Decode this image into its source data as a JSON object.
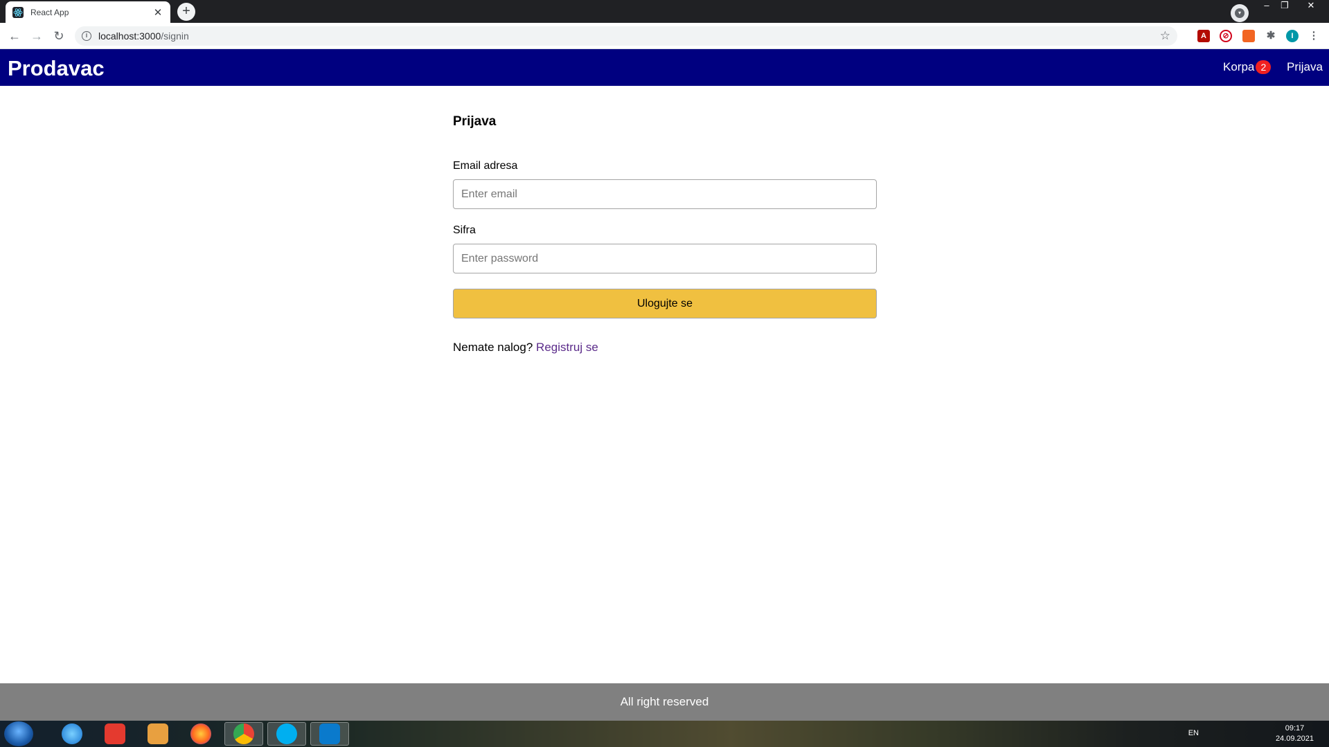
{
  "browser": {
    "tab_title": "React App",
    "tab_close": "✕",
    "new_tab": "+",
    "url_host": "localhost:3000",
    "url_path": "/signin"
  },
  "header": {
    "brand": "Prodavac",
    "cart_label": "Korpa",
    "cart_count": "2",
    "signin_label": "Prijava"
  },
  "form": {
    "title": "Prijava",
    "email_label": "Email adresa",
    "email_placeholder": "Enter email",
    "password_label": "Sifra",
    "password_placeholder": "Enter password",
    "submit_label": "Ulogujte se",
    "register_prompt": "Nemate nalog?",
    "register_link": "Registruj se"
  },
  "footer": {
    "text": "All right reserved"
  },
  "taskbar": {
    "language": "EN",
    "time": "09:17",
    "date": "24.09.2021",
    "apps": [
      "internet-explorer-icon",
      "screen-recorder-icon",
      "media-player-icon",
      "firefox-icon",
      "chrome-icon",
      "skype-icon",
      "vscode-icon"
    ]
  },
  "colors": {
    "header_bg": "#000080",
    "button_bg": "#f0c040",
    "badge_bg": "#f02020",
    "footer_bg": "#808080",
    "link": "#5b2b8a"
  }
}
